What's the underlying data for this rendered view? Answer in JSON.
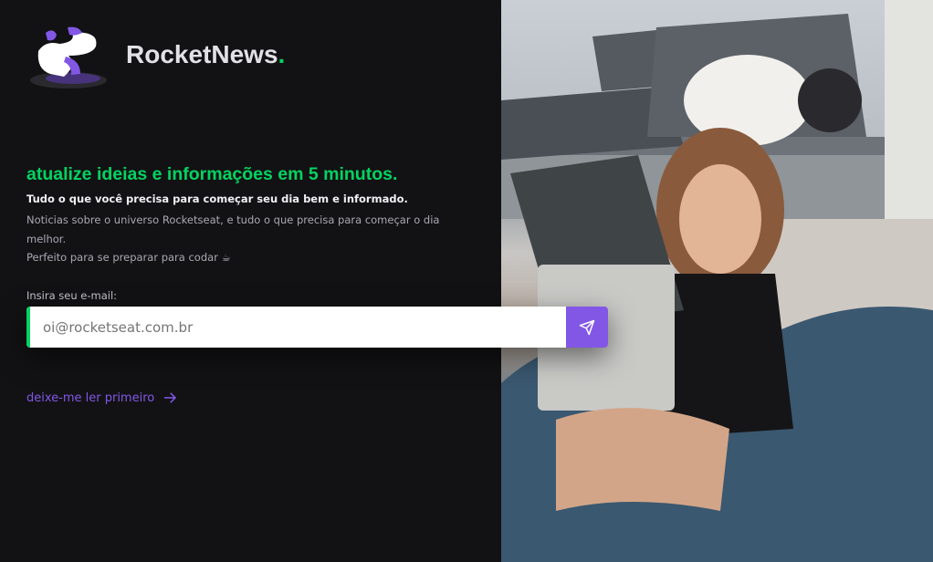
{
  "brand": {
    "name": "RocketNews",
    "dot": "."
  },
  "hero": {
    "headline": "atualize ideias e informações em 5 minutos.",
    "subtitle": "Tudo o que você precisa para começar seu dia bem e informado.",
    "description": "Noticias sobre o universo Rocketseat, e tudo o que precisa para começar o dia melhor.",
    "tagline": "Perfeito para se preparar para codar ☕"
  },
  "form": {
    "label": "Insira seu e-mail:",
    "placeholder": "oi@rocketseat.com.br"
  },
  "link": {
    "label": "deixe-me ler primeiro"
  },
  "colors": {
    "accent": "#8257e5",
    "green": "#04d361",
    "bg": "#121214"
  }
}
